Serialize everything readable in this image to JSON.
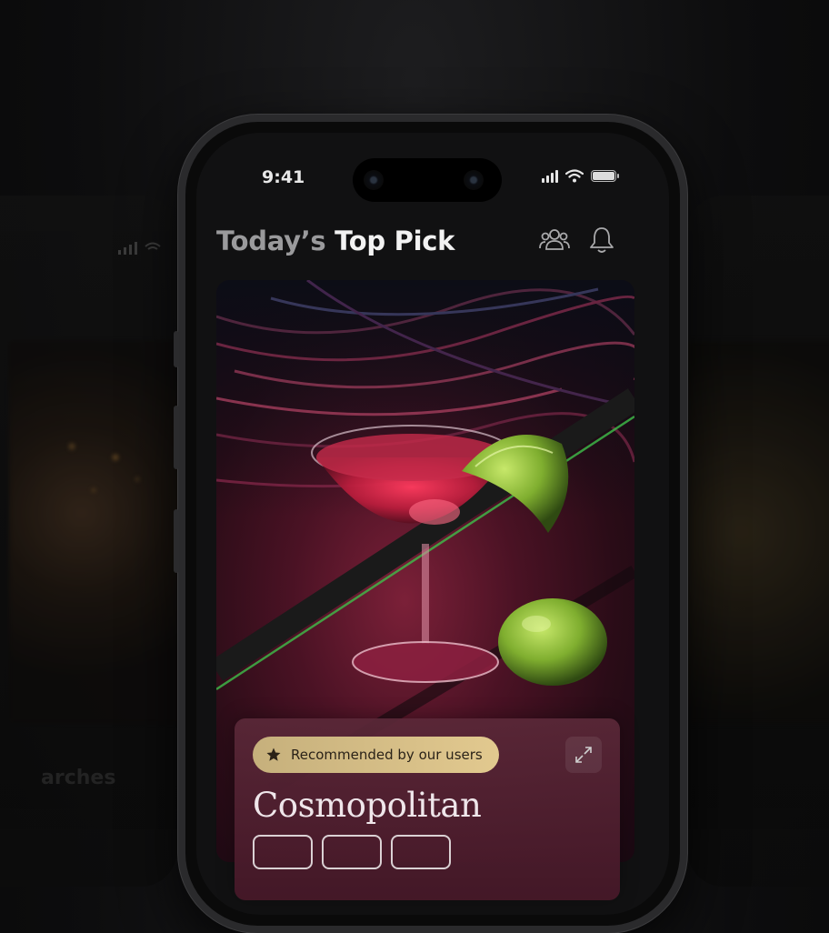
{
  "status_bar": {
    "time": "9:41"
  },
  "header": {
    "title_part1": "Today’s",
    "title_part2": "Top Pick",
    "icons": [
      "users-icon",
      "bell-icon"
    ]
  },
  "featured": {
    "badge_icon": "star-icon",
    "badge_label": "Recommended by our users",
    "expand_icon": "expand-icon",
    "name": "Cosmopolitan"
  },
  "background": {
    "left_phone_text": "arches"
  },
  "colors": {
    "badge_gold": "#d9c088",
    "hero_crimson": "#7b2038",
    "panel": "#5a2838",
    "accent_green": "#3fbf4a",
    "lime": "#a9d24a"
  }
}
